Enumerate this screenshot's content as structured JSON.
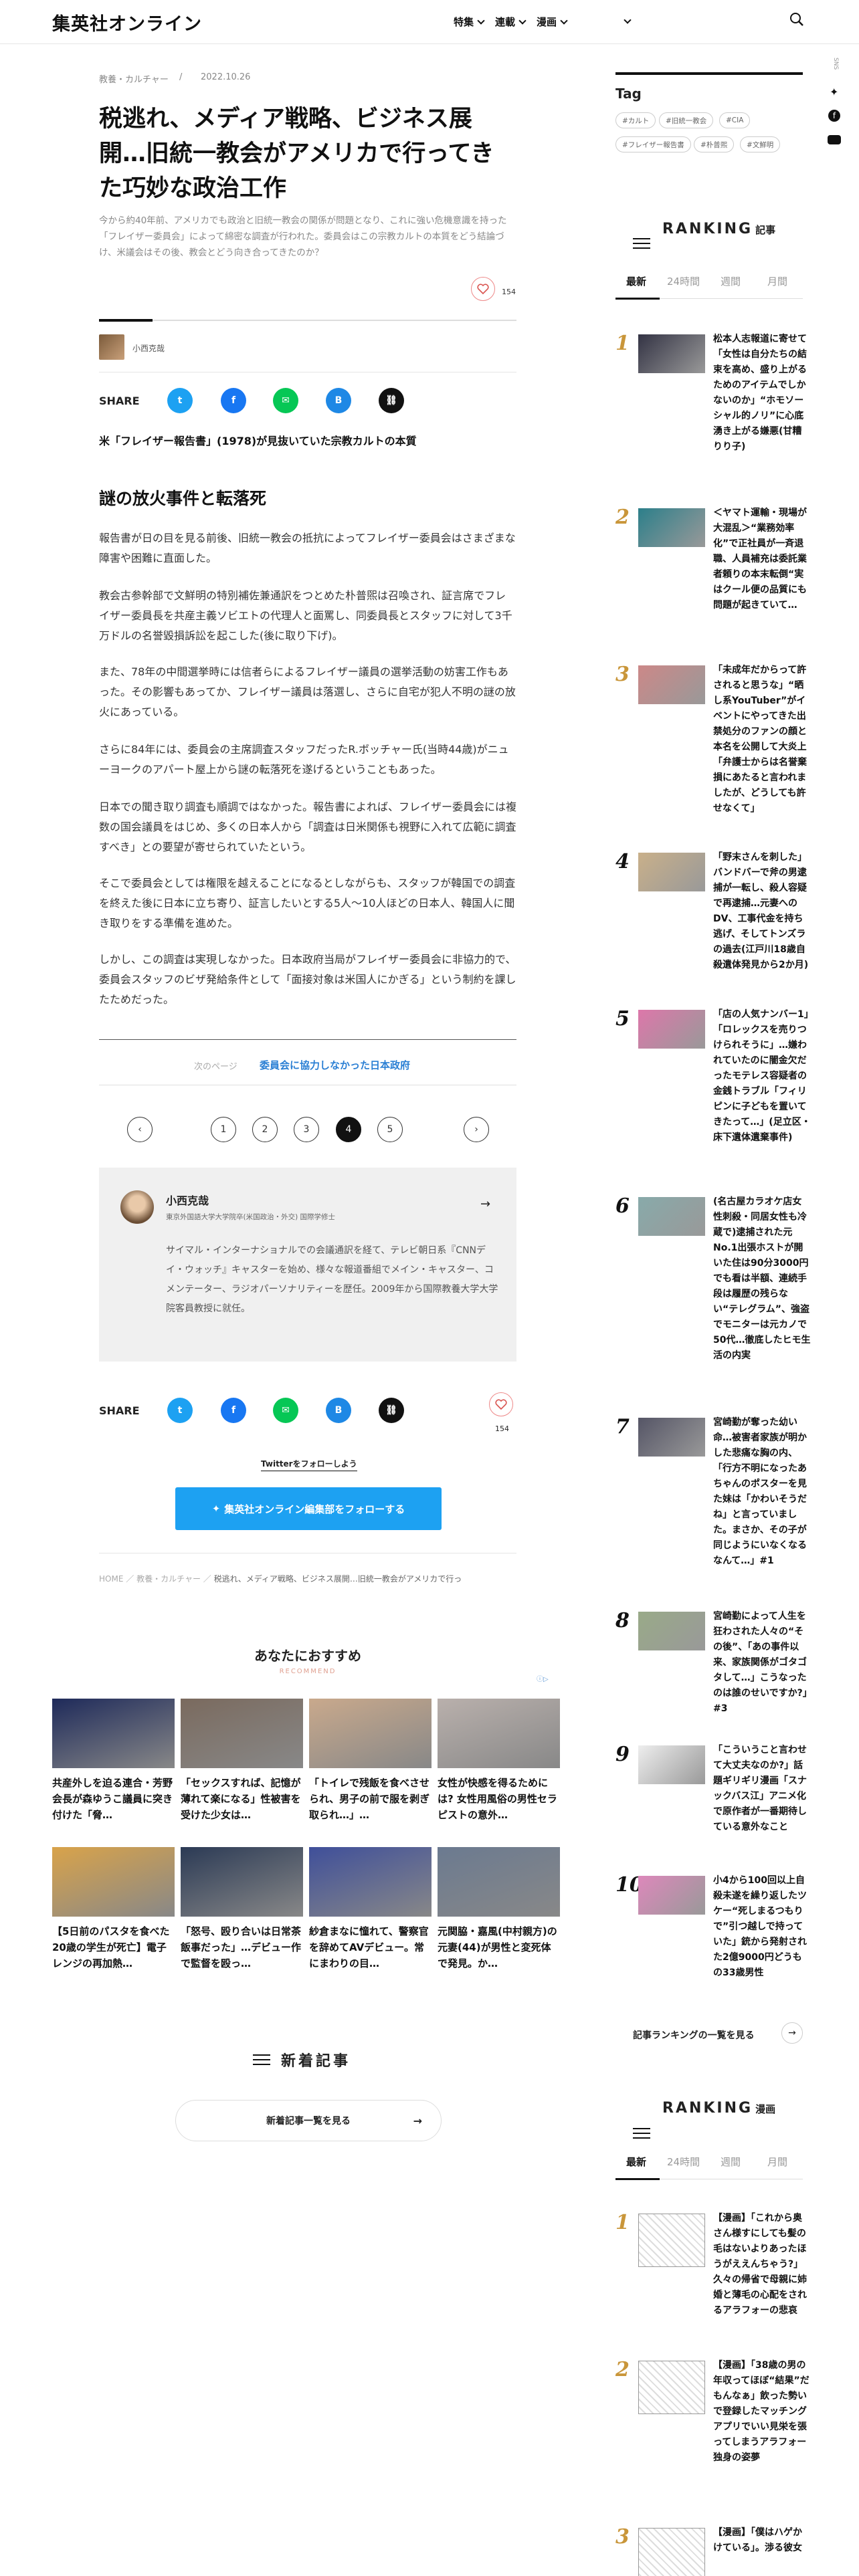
{
  "header": {
    "logo": "集英社オンライン",
    "nav": [
      "特集",
      "連載",
      "漫画"
    ]
  },
  "article": {
    "category": "教養・カルチャー",
    "date": "2022.10.26",
    "title": "税逃れ、メディア戦略、ビジネス展開…旧統一教会がアメリカで行ってきた巧妙な政治工作",
    "lead": "今から約40年前、アメリカでも政治と旧統一教会の関係が問題となり、これに強い危機意識を持った「フレイザー委員会」によって綿密な調査が行われた。委員会はこの宗教カルトの本質をどう結論づけ、米議会はその後、教会とどう向き合ってきたのか？",
    "like_count": "154",
    "author": "小西克哉",
    "share_label": "SHARE",
    "section_note": "米「フレイザー報告書」(1978)が見抜いていた宗教カルトの本質",
    "heading": "謎の放火事件と転落死",
    "paragraphs": [
      "報告書が日の目を見る前後、旧統一教会の抵抗によってフレイザー委員会はさまざまな障害や困難に直面した。",
      "教会古参幹部で文鮮明の特別補佐兼通訳をつとめた朴普煕は召喚され、証言席でフレイザー委員長を共産主義ソビエトの代理人と面罵し、同委員長とスタッフに対して3千万ドルの名誉毀損訴訟を起こした(後に取り下げ)。",
      "また、78年の中間選挙時には信者らによるフレイザー議員の選挙活動の妨害工作もあった。その影響もあってか、フレイザー議員は落選し、さらに自宅が犯人不明の謎の放火にあっている。",
      "さらに84年には、委員会の主席調査スタッフだったR.ボッチャー氏(当時44歳)がニューヨークのアパート屋上から謎の転落死を遂げるということもあった。",
      "日本での聞き取り調査も順調ではなかった。報告書によれば、フレイザー委員会には複数の国会議員をはじめ、多くの日本人から「調査は日米関係も視野に入れて広範に調査すべき」との要望が寄せられていたという。",
      "そこで委員会としては権限を越えることになるとしながらも、スタッフが韓国での調査を終えた後に日本に立ち寄り、証言したいとする5人〜10人ほどの日本人、韓国人に聞き取りをする準備を進めた。",
      "しかし、この調査は実現しなかった。日本政府当局がフレイザー委員会に非協力的で、委員会スタッフのビザ発給条件として「面接対象は米国人にかぎる」という制約を課したためだった。"
    ],
    "next_label": "次のページ",
    "next_title": "委員会に協力しなかった日本政府",
    "pages": [
      "1",
      "2",
      "3",
      "4",
      "5"
    ],
    "current_page": "4",
    "bio_name": "小西克哉",
    "bio_role": "東京外国語大学大学院卒(米国政治・外交) 国際学修士",
    "bio_text": "サイマル・インターナショナルでの会議通訳を経て、テレビ朝日系『CNNデイ・ウォッチ』キャスターを始め、様々な報道番組でメイン・キャスター、コメンテーター、ラジオパーソナリティーを歴任。2009年から国際教養大学大学院客員教授に就任。",
    "twitter_hint": "Twitterをフォローしよう",
    "twitter_btn": "集英社オンライン編集部をフォローする",
    "breadcrumb": [
      "HOME",
      "教養・カルチャー",
      "税逃れ、メディア戦略、ビジネス展開…旧統一教会がアメリカで行っ"
    ]
  },
  "reco": {
    "title": "あなたにおすすめ",
    "sub": "RECOMMEND",
    "items": [
      {
        "t": "共産外しを迫る連合・芳野会長が森ゆうこ議員に突き付けた「脅…",
        "c": "#1e2a5a"
      },
      {
        "t": "「セックスすれば、記憶が薄れて楽になる」性被害を受けた少女は…",
        "c": "#7a6a5e"
      },
      {
        "t": "「トイレで残飯を食べさせられ、男子の前で服を剥ぎ取られ…」…",
        "c": "#c9a98c"
      },
      {
        "t": "女性が快感を得るためには? 女性用風俗の男性セラピストの意外…",
        "c": "#b9b0ac"
      },
      {
        "t": "【5日前のパスタを食べた20歳の学生が死亡】電子レンジの再加熱…",
        "c": "#d9a34a"
      },
      {
        "t": "「怒号、殴り合いは日常茶飯事だった」…デビュー作で監督を殴っ…",
        "c": "#2b3a55"
      },
      {
        "t": "紗倉まなに憧れて、警察官を辞めてAVデビュー。常にまわりの目…",
        "c": "#3f4f9a"
      },
      {
        "t": "元関脇・嘉風(中村親方)の元妻(44)が男性と変死体で発見。か…",
        "c": "#6b7a90"
      }
    ]
  },
  "newest": {
    "title": "新着記事",
    "btn": "新着記事一覧を見る"
  },
  "side": {
    "tag_title": "Tag",
    "tags": [
      "#カルト",
      "#旧統一教会",
      "#CIA",
      "#フレイザー報告書",
      "#朴普煕",
      "#文鮮明"
    ],
    "ranking_title": "RANKING",
    "ranking_sub": "記事",
    "tabs": [
      "最新",
      "24時間",
      "週間",
      "月間"
    ],
    "ranking": [
      {
        "n": "1",
        "t": "松本人志報道に寄せて「女性は自分たちの結束を高め、盛り上がるためのアイテムでしかないのか」“ホモソーシャル的ノリ”に心底湧き上がる嫌悪(甘糟りり子)",
        "c": "#334"
      },
      {
        "n": "2",
        "t": "＜ヤマト運輸・現場が大混乱＞“業務効率化”で正社員が一斉退職、人員補充は委託業者頼りの本末転倒“実はクール便の品質にも問題が起きていて…",
        "c": "#2c7f8a"
      },
      {
        "n": "3",
        "t": "「未成年だからって許されると思うな」“晒し系YouTuber”がイベントにやってきた出禁処分のファンの顔と本名を公開して大炎上「弁護士からは名誉棄損にあたると言われましたが、どうしても許せなくて」",
        "c": "#c88"
      },
      {
        "n": "4",
        "t": "「野末さんを刺した」バンドバーで斧の男逮捕が一転し、殺人容疑で再逮捕…元妻へのDV、工事代金を持ち逃げ、そしてトンズラの過去(江戸川18歳自殺遺体発見から2か月)",
        "c": "#c9b08a"
      },
      {
        "n": "5",
        "t": "「店の人気ナンバー1」「ロレックスを売りつけられそうに」…嫌われていたのに闇金欠だったモテレス容疑者の金銭トラブル「フィリピンに子どもを置いてきたって…」(足立区・床下遺体遺棄事件)",
        "c": "#d7a"
      },
      {
        "n": "6",
        "t": "(名古屋カラオケ店女性刺殺・同居女性も冷蔵で)逮捕された元No.1出張ホストが開いた住は90分3000円でも看は半額、連続手段は履歴の残らない“テレグラム”、強盗でモニターは元カノで50代…徹底したヒモ生活の内実",
        "c": "#8aa"
      },
      {
        "n": "7",
        "t": "宮崎勤が奪った幼い命…被害者家族が明かした悲痛な胸の内、「行方不明になったあちゃんのポスターを見た妹は「かわいそうだね」と言っていました。まさか、その子が同じようにいなくなるなんて…」#1",
        "c": "#556"
      },
      {
        "n": "8",
        "t": "宮崎勤によって人生を狂わされた人々の“その後”、「あの事件以来、家族関係がゴタゴタして…」こうなったのは誰のせいですか?」#3",
        "c": "#9a8"
      },
      {
        "n": "9",
        "t": "「こういうこと言わせて大丈夫なのか?」話題ギリギリ漫画「スナックバス江」アニメ化で原作者が一番期待している意外なこと",
        "c": "#eee"
      },
      {
        "n": "10",
        "t": "小4から100回以上自殺未遂を繰り返したツケー“死しまるつもりで”引つ越しで持っていた」銃から発射された2億9000円どうもの33歳男性",
        "c": "#d8b"
      }
    ],
    "ranking_more": "記事ランキングの一覧を見る",
    "manga_title": "RANKING",
    "manga_sub": "漫画",
    "manga": [
      {
        "n": "1",
        "t": "【漫画】「これから奥さん様すにしても髪の毛はないよりあったほうがええんちゃう?」久々の帰省で母親に姉婚と薄毛の心配をされるアラフォーの悲哀"
      },
      {
        "n": "2",
        "t": "【漫画】「38歳の男の年収ってほぼ“結果”だもんなぁ」飲った勢いで登録したマッチングアプリでいい見栄を張ってしまうアラフォー独身の姿夢"
      },
      {
        "n": "3",
        "t": "【漫画】「僕はハゲかけている」。渉る彼女"
      }
    ]
  },
  "theme": {
    "accent": "#1da1f2",
    "red": "#d9534f",
    "gold": "#c9963a"
  }
}
